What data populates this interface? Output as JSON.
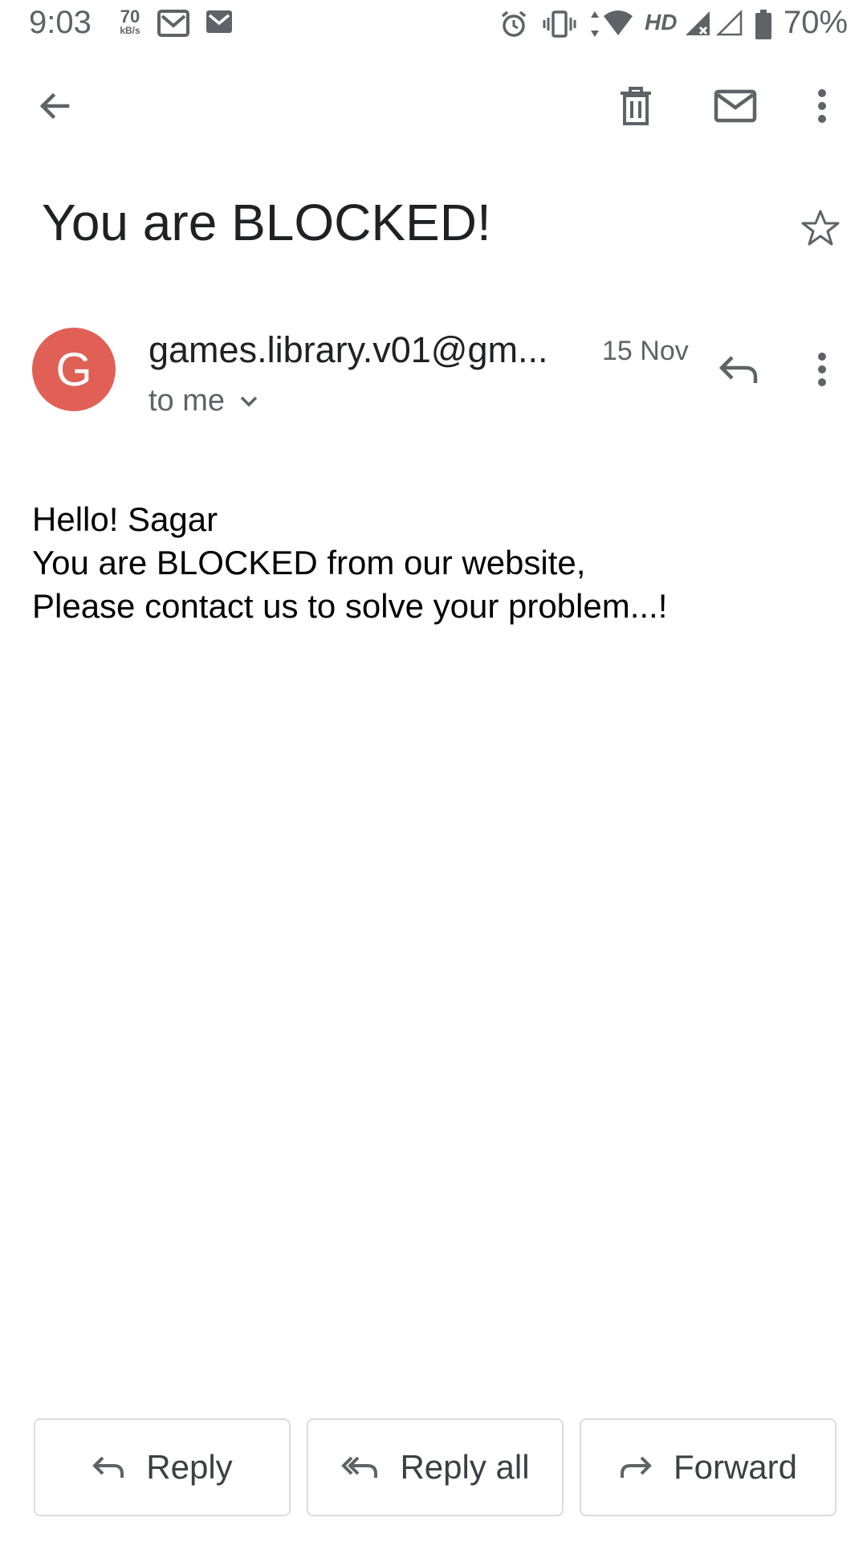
{
  "status_bar": {
    "time": "9:03",
    "speed_value": "70",
    "speed_unit": "kB/s",
    "hd_label": "HD",
    "battery_percent": "70%"
  },
  "app_bar": {
    "icons": [
      "back-arrow-icon",
      "delete-icon",
      "mark-unread-icon",
      "more-options-icon"
    ]
  },
  "email": {
    "subject": "You are BLOCKED!",
    "sender_initial": "G",
    "sender": "games.library.v01@gm...",
    "date": "15 Nov",
    "recipient": "to me",
    "body_lines": [
      "Hello! Sagar",
      "You are BLOCKED from our website,",
      "Please contact us to solve your problem...!"
    ]
  },
  "actions": {
    "reply": "Reply",
    "reply_all": "Reply all",
    "forward": "Forward"
  },
  "colors": {
    "avatar": "#e06055",
    "icon_gray": "#5f6368",
    "text_primary": "#202124"
  }
}
